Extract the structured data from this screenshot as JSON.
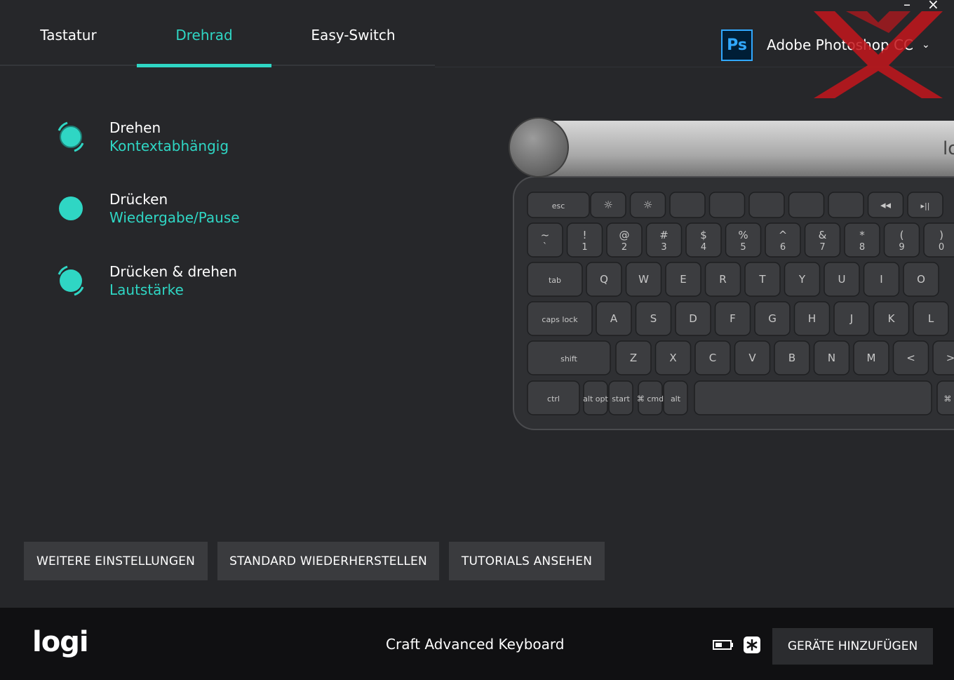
{
  "window": {
    "minimize_glyph": "–",
    "close_glyph": "×"
  },
  "tabs": [
    {
      "label": "Tastatur",
      "active": false
    },
    {
      "label": "Drehrad",
      "active": true
    },
    {
      "label": "Easy-Switch",
      "active": false
    }
  ],
  "app_selector": {
    "icon_text": "Ps",
    "app_name": "Adobe Photoshop CC",
    "chevron": "⌄"
  },
  "actions": [
    {
      "label": "Drehen",
      "value": "Kontextabhängig",
      "icon": "rotate-dial-icon"
    },
    {
      "label": "Drücken",
      "value": "Wiedergabe/Pause",
      "icon": "press-dial-icon"
    },
    {
      "label": "Drücken & drehen",
      "value": "Lautstärke",
      "icon": "press-rotate-dial-icon"
    }
  ],
  "buttons": {
    "more_settings": "WEITERE EINSTELLUNGEN",
    "restore_defaults": "STANDARD WIEDERHERSTELLEN",
    "tutorials": "TUTORIALS ANSEHEN"
  },
  "footer": {
    "logo": "logi",
    "device_name": "Craft Advanced Keyboard",
    "add_devices": "GERÄTE HINZUFÜGEN"
  },
  "keyboard": {
    "fn_row": [
      "esc",
      "☼",
      "☼",
      "",
      "",
      "",
      "",
      "",
      "◂◂",
      "▸||"
    ],
    "num_row": [
      [
        "~",
        "`"
      ],
      [
        "!",
        "1"
      ],
      [
        "@",
        "2"
      ],
      [
        "#",
        "3"
      ],
      [
        "$",
        "4"
      ],
      [
        "%",
        "5"
      ],
      [
        "^",
        "6"
      ],
      [
        "&",
        "7"
      ],
      [
        "*",
        "8"
      ],
      [
        "(",
        "9"
      ],
      [
        ")",
        "0"
      ]
    ],
    "q_row": [
      "tab",
      "Q",
      "W",
      "E",
      "R",
      "T",
      "Y",
      "U",
      "I",
      "O"
    ],
    "a_row": [
      "caps lock",
      "A",
      "S",
      "D",
      "F",
      "G",
      "H",
      "J",
      "K",
      "L"
    ],
    "z_row": [
      "shift",
      "Z",
      "X",
      "C",
      "V",
      "B",
      "N",
      "M",
      "<",
      ">"
    ],
    "bottom_row": [
      "ctrl",
      "alt opt",
      "start",
      "⌘ cmd",
      "alt",
      "",
      "⌘ cm"
    ],
    "brand": "lo"
  },
  "colors": {
    "accent": "#2fd6c4",
    "background": "#26272a",
    "footer": "#101012",
    "button": "#3a3b3e"
  }
}
